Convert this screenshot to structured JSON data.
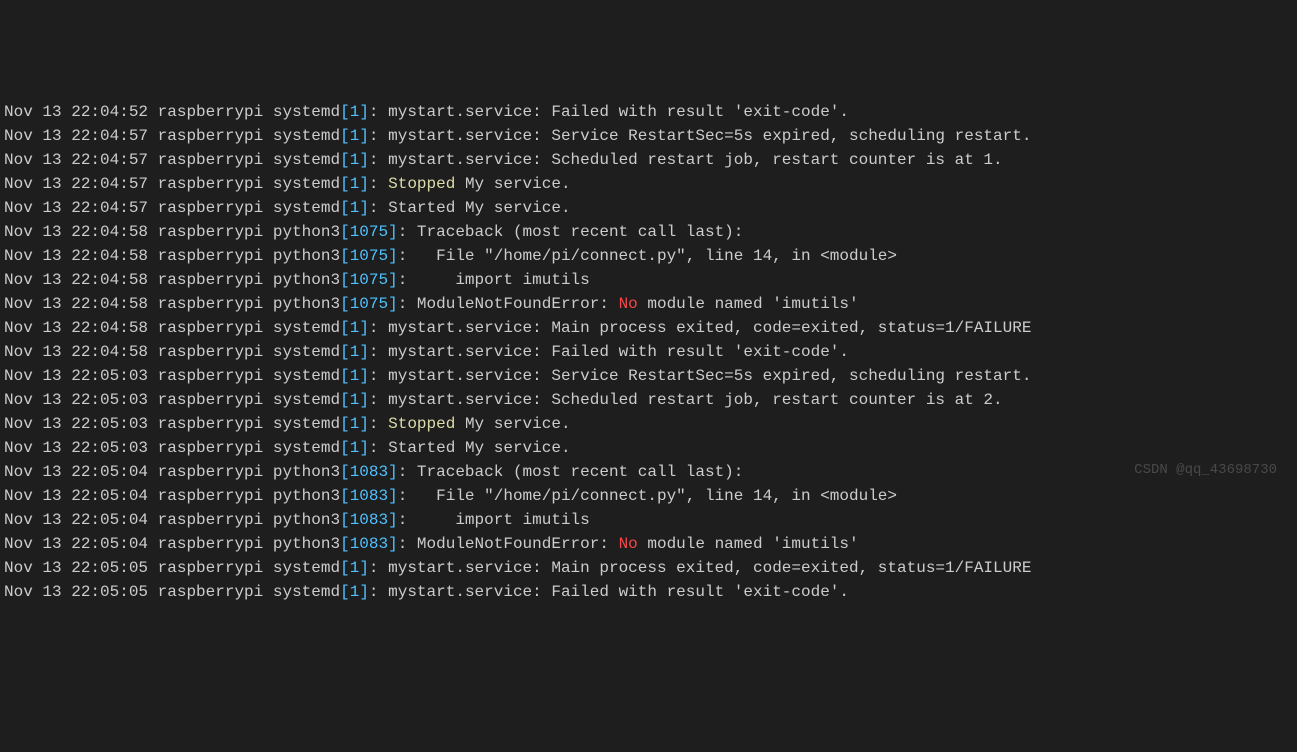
{
  "lines": [
    {
      "ts": "Nov 13 22:04:52",
      "host": "raspberrypi",
      "proc": "systemd",
      "pid": "1",
      "msg": "mystart.service: Failed with result 'exit-code'."
    },
    {
      "ts": "Nov 13 22:04:57",
      "host": "raspberrypi",
      "proc": "systemd",
      "pid": "1",
      "msg": "mystart.service: Service RestartSec=5s expired, scheduling restart."
    },
    {
      "ts": "Nov 13 22:04:57",
      "host": "raspberrypi",
      "proc": "systemd",
      "pid": "1",
      "msg": "mystart.service: Scheduled restart job, restart counter is at 1."
    },
    {
      "ts": "Nov 13 22:04:57",
      "host": "raspberrypi",
      "proc": "systemd",
      "pid": "1",
      "hl": "Stopped",
      "hlClass": "yellow",
      "rest": " My service."
    },
    {
      "ts": "Nov 13 22:04:57",
      "host": "raspberrypi",
      "proc": "systemd",
      "pid": "1",
      "msg": "Started My service."
    },
    {
      "ts": "Nov 13 22:04:58",
      "host": "raspberrypi",
      "proc": "python3",
      "pid": "1075",
      "msg": "Traceback (most recent call last):"
    },
    {
      "ts": "Nov 13 22:04:58",
      "host": "raspberrypi",
      "proc": "python3",
      "pid": "1075",
      "msg": "  File \"/home/pi/connect.py\", line 14, in <module>"
    },
    {
      "ts": "Nov 13 22:04:58",
      "host": "raspberrypi",
      "proc": "python3",
      "pid": "1075",
      "msg": "    import imutils"
    },
    {
      "ts": "Nov 13 22:04:58",
      "host": "raspberrypi",
      "proc": "python3",
      "pid": "1075",
      "pre": "ModuleNotFoundError: ",
      "hl": "No",
      "hlClass": "red",
      "rest": " module named 'imutils'"
    },
    {
      "ts": "Nov 13 22:04:58",
      "host": "raspberrypi",
      "proc": "systemd",
      "pid": "1",
      "msg": "mystart.service: Main process exited, code=exited, status=1/FAILURE"
    },
    {
      "ts": "Nov 13 22:04:58",
      "host": "raspberrypi",
      "proc": "systemd",
      "pid": "1",
      "msg": "mystart.service: Failed with result 'exit-code'."
    },
    {
      "ts": "Nov 13 22:05:03",
      "host": "raspberrypi",
      "proc": "systemd",
      "pid": "1",
      "msg": "mystart.service: Service RestartSec=5s expired, scheduling restart."
    },
    {
      "ts": "Nov 13 22:05:03",
      "host": "raspberrypi",
      "proc": "systemd",
      "pid": "1",
      "msg": "mystart.service: Scheduled restart job, restart counter is at 2."
    },
    {
      "ts": "Nov 13 22:05:03",
      "host": "raspberrypi",
      "proc": "systemd",
      "pid": "1",
      "hl": "Stopped",
      "hlClass": "yellow",
      "rest": " My service."
    },
    {
      "ts": "Nov 13 22:05:03",
      "host": "raspberrypi",
      "proc": "systemd",
      "pid": "1",
      "msg": "Started My service."
    },
    {
      "ts": "Nov 13 22:05:04",
      "host": "raspberrypi",
      "proc": "python3",
      "pid": "1083",
      "msg": "Traceback (most recent call last):"
    },
    {
      "ts": "Nov 13 22:05:04",
      "host": "raspberrypi",
      "proc": "python3",
      "pid": "1083",
      "msg": "  File \"/home/pi/connect.py\", line 14, in <module>"
    },
    {
      "ts": "Nov 13 22:05:04",
      "host": "raspberrypi",
      "proc": "python3",
      "pid": "1083",
      "msg": "    import imutils"
    },
    {
      "ts": "Nov 13 22:05:04",
      "host": "raspberrypi",
      "proc": "python3",
      "pid": "1083",
      "pre": "ModuleNotFoundError: ",
      "hl": "No",
      "hlClass": "red",
      "rest": " module named 'imutils'"
    },
    {
      "ts": "Nov 13 22:05:05",
      "host": "raspberrypi",
      "proc": "systemd",
      "pid": "1",
      "msg": "mystart.service: Main process exited, code=exited, status=1/FAILURE"
    },
    {
      "ts": "Nov 13 22:05:05",
      "host": "raspberrypi",
      "proc": "systemd",
      "pid": "1",
      "msg": "mystart.service: Failed with result 'exit-code'."
    }
  ],
  "watermark": "CSDN @qq_43698730"
}
